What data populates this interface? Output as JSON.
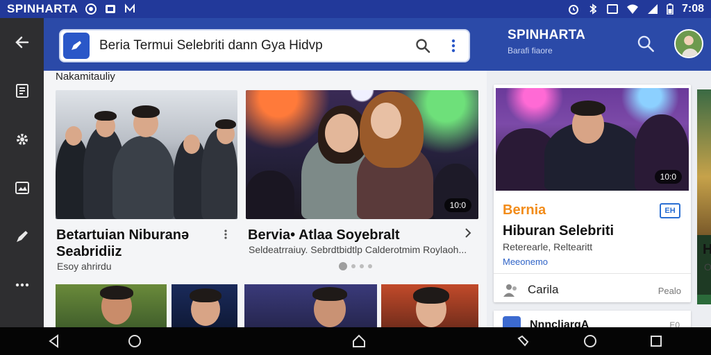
{
  "status_bar": {
    "brand": "SPINHARTA",
    "left_icons": [
      "record-icon",
      "notification-icon",
      "app-m-icon"
    ],
    "time": "7:08",
    "right_icons": [
      "alarm-icon",
      "bluetooth-icon",
      "screen-icon",
      "wifi-icon",
      "signal-icon",
      "battery-icon"
    ]
  },
  "nav_rail": {
    "items": [
      {
        "icon": "back-arrow-icon"
      },
      {
        "icon": "document-icon"
      },
      {
        "icon": "gear-icon"
      },
      {
        "icon": "image-icon"
      },
      {
        "icon": "pen-icon"
      },
      {
        "icon": "more-horizontal-icon"
      }
    ]
  },
  "search": {
    "query": "Beria Termui Selebriti dann Gya Hidvp",
    "search_icon": "search-icon",
    "menu_icon": "kebab-icon"
  },
  "header": {
    "brand_title": "SPINHARTA",
    "brand_subtitle": "Barafi fiaore"
  },
  "main": {
    "section_title": "Nakamitauliy",
    "cards": [
      {
        "title": "Betartuian Niburanə Seabridiiz",
        "subtitle": "Esoy ahrirdu"
      },
      {
        "title": "Bervia• Atlaa Soyebralt",
        "subtitle": "Seldeatrraiuy. Sebrdtbidtlp Calderotmim Roylaoh...",
        "badge": "10:0"
      }
    ],
    "carousel_dots": 4
  },
  "right_card": {
    "badge": "10:0",
    "tag": "Bernia",
    "title": "Hiburan Selebriti",
    "subtitle": "Reterearle, Reltearitt",
    "link": "Meeonemo",
    "action_label": "Carila",
    "action_meta": "Pealo",
    "icon_text": "EH"
  },
  "right_card2": {
    "title": "NnncliargA",
    "meta": "E0"
  },
  "edge_card": {
    "letters": "H",
    "sub": "O"
  },
  "colors": {
    "status_bar": "#22399a",
    "top_bar": "#2b4aa8",
    "accent_orange": "#f28c1a",
    "link_blue": "#2f63c7"
  }
}
